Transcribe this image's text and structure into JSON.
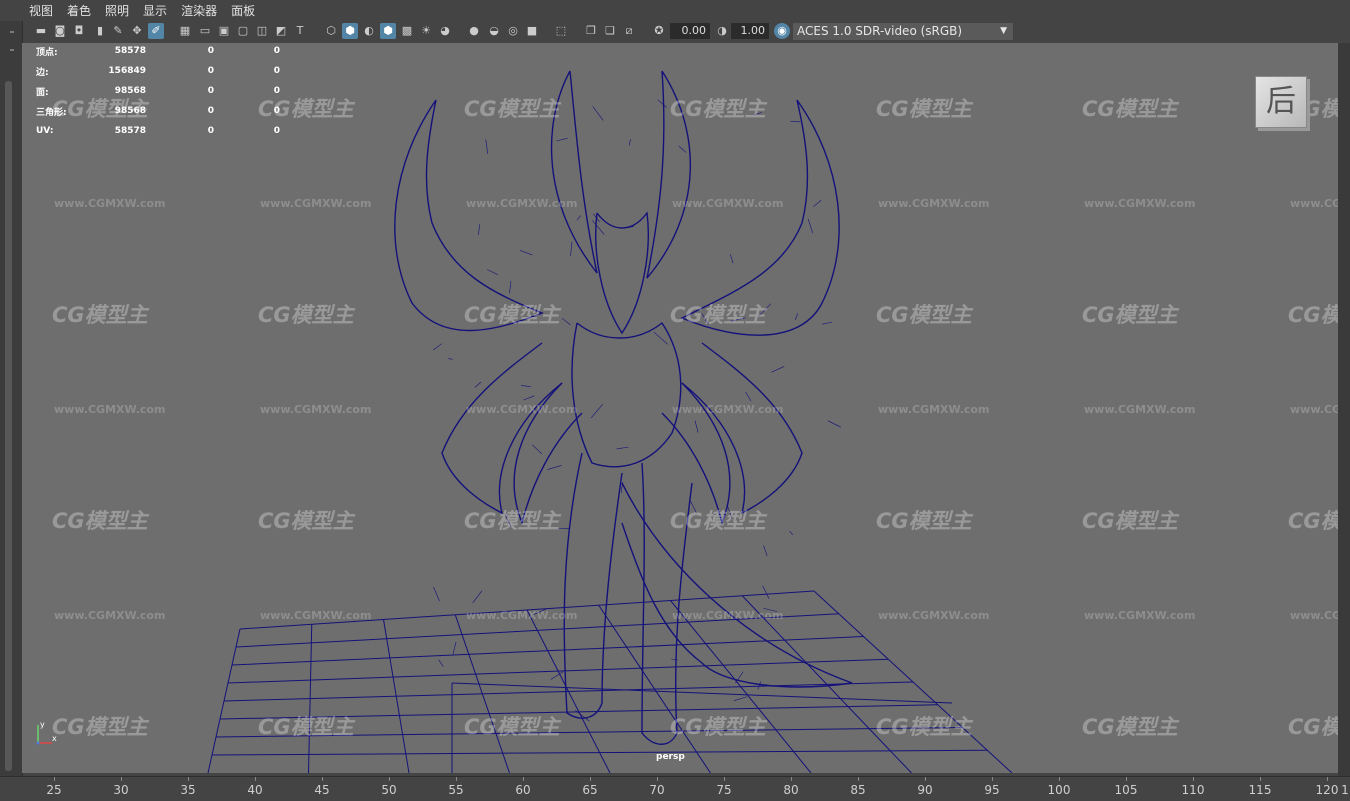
{
  "menu": [
    "视图",
    "着色",
    "照明",
    "显示",
    "渲染器",
    "面板"
  ],
  "toolbar": {
    "exposure_value": "0.00",
    "gamma_value": "1.00",
    "color_space": "ACES 1.0 SDR-video (sRGB)"
  },
  "hud": {
    "rows": [
      {
        "label": "顶点:",
        "v1": "58578",
        "v2": "0",
        "v3": "0"
      },
      {
        "label": "边:",
        "v1": "156849",
        "v2": "0",
        "v3": "0"
      },
      {
        "label": "面:",
        "v1": "98568",
        "v2": "0",
        "v3": "0"
      },
      {
        "label": "三角形:",
        "v1": "98568",
        "v2": "0",
        "v3": "0"
      },
      {
        "label": "UV:",
        "v1": "58578",
        "v2": "0",
        "v3": "0"
      }
    ]
  },
  "viewcube_label": "后",
  "camera_label": "persp",
  "axis": {
    "x": "x",
    "y": "y"
  },
  "watermark": {
    "logo": "CG模型主",
    "url": "www.CGMXW.com"
  },
  "timeline": {
    "ticks": [
      "25",
      "30",
      "35",
      "40",
      "45",
      "50",
      "55",
      "60",
      "65",
      "70",
      "75",
      "80",
      "85",
      "90",
      "95",
      "100",
      "105",
      "110",
      "115",
      "120"
    ],
    "edge_label": "1"
  },
  "colors": {
    "wireframe": "#14127a",
    "viewport_bg": "#6e6e6e",
    "ui_bg": "#444444",
    "accent": "#5285a6"
  }
}
